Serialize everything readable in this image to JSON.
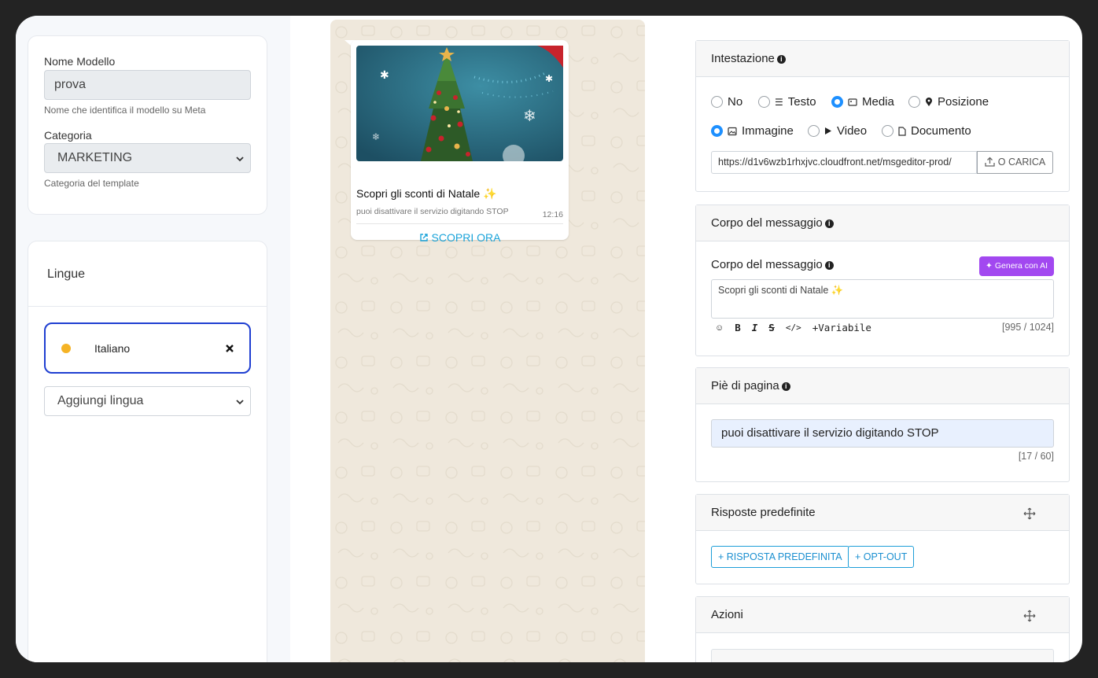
{
  "template_form": {
    "name_label": "Nome Modello",
    "name_value": "prova",
    "name_help": "Nome che identifica il modello su Meta",
    "category_label": "Categoria",
    "category_value": "MARKETING",
    "category_help": "Categoria del template"
  },
  "languages": {
    "title": "Lingue",
    "items": [
      {
        "label": "Italiano",
        "status_color": "#f5b325"
      }
    ],
    "add_placeholder": "Aggiungi lingua"
  },
  "preview": {
    "title": "Scopri gli sconti di Natale ✨",
    "footer": "puoi disattivare il servizio digitando STOP",
    "time": "12:16",
    "cta_label": "SCOPRI ORA"
  },
  "header_section": {
    "title": "Intestazione",
    "options": [
      "No",
      "Testo",
      "Media",
      "Posizione"
    ],
    "selected": "Media",
    "media_types": [
      "Immagine",
      "Video",
      "Documento"
    ],
    "selected_media": "Immagine",
    "url": "https://d1v6wzb1rhxjvc.cloudfront.net/msgeditor-prod/",
    "upload_label": "O CARICA"
  },
  "body_section": {
    "title": "Corpo del messaggio",
    "field_label": "Corpo del messaggio",
    "ai_button": "Genera con AI",
    "text": "Scopri gli sconti di Natale ✨",
    "toolbar": [
      "B",
      "I",
      "S",
      "</>",
      "+Variabile"
    ],
    "counter": "[995 / 1024]"
  },
  "footer_section": {
    "title": "Piè di pagina",
    "text": "puoi disattivare il servizio digitando STOP",
    "counter": "[17 / 60]"
  },
  "quick_replies": {
    "title": "Risposte predefinite",
    "add_reply": "+ RISPOSTA PREDEFINITA",
    "add_optout": "+ OPT-OUT"
  },
  "actions": {
    "title": "Azioni"
  },
  "colors": {
    "accent": "#1e90ff",
    "ai_purple": "#a248f0",
    "link_blue": "#1a8fd0"
  }
}
